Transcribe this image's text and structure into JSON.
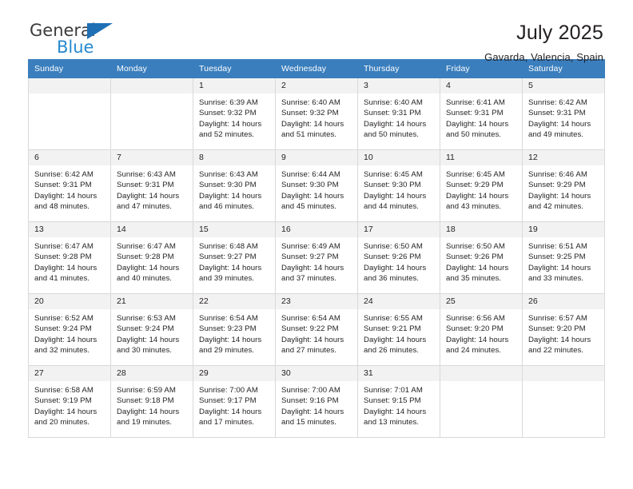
{
  "brand": {
    "name_top": "General",
    "name_bottom": "Blue",
    "triangle_color": "#1f6fb5",
    "blue_color": "#2789d0"
  },
  "header": {
    "month_title": "July 2025",
    "location": "Gavarda, Valencia, Spain"
  },
  "theme": {
    "header_bg": "#3a7ebd",
    "header_text": "#ffffff",
    "daynum_bg": "#f2f2f2",
    "grid_border": "#d9d9d9",
    "text": "#231f20"
  },
  "calendar": {
    "weekday_headers": [
      "Sunday",
      "Monday",
      "Tuesday",
      "Wednesday",
      "Thursday",
      "Friday",
      "Saturday"
    ],
    "weeks": [
      [
        {
          "day": "",
          "blank": true
        },
        {
          "day": "",
          "blank": true
        },
        {
          "day": "1",
          "sunrise": "Sunrise: 6:39 AM",
          "sunset": "Sunset: 9:32 PM",
          "daylight1": "Daylight: 14 hours",
          "daylight2": "and 52 minutes."
        },
        {
          "day": "2",
          "sunrise": "Sunrise: 6:40 AM",
          "sunset": "Sunset: 9:32 PM",
          "daylight1": "Daylight: 14 hours",
          "daylight2": "and 51 minutes."
        },
        {
          "day": "3",
          "sunrise": "Sunrise: 6:40 AM",
          "sunset": "Sunset: 9:31 PM",
          "daylight1": "Daylight: 14 hours",
          "daylight2": "and 50 minutes."
        },
        {
          "day": "4",
          "sunrise": "Sunrise: 6:41 AM",
          "sunset": "Sunset: 9:31 PM",
          "daylight1": "Daylight: 14 hours",
          "daylight2": "and 50 minutes."
        },
        {
          "day": "5",
          "sunrise": "Sunrise: 6:42 AM",
          "sunset": "Sunset: 9:31 PM",
          "daylight1": "Daylight: 14 hours",
          "daylight2": "and 49 minutes."
        }
      ],
      [
        {
          "day": "6",
          "sunrise": "Sunrise: 6:42 AM",
          "sunset": "Sunset: 9:31 PM",
          "daylight1": "Daylight: 14 hours",
          "daylight2": "and 48 minutes."
        },
        {
          "day": "7",
          "sunrise": "Sunrise: 6:43 AM",
          "sunset": "Sunset: 9:31 PM",
          "daylight1": "Daylight: 14 hours",
          "daylight2": "and 47 minutes."
        },
        {
          "day": "8",
          "sunrise": "Sunrise: 6:43 AM",
          "sunset": "Sunset: 9:30 PM",
          "daylight1": "Daylight: 14 hours",
          "daylight2": "and 46 minutes."
        },
        {
          "day": "9",
          "sunrise": "Sunrise: 6:44 AM",
          "sunset": "Sunset: 9:30 PM",
          "daylight1": "Daylight: 14 hours",
          "daylight2": "and 45 minutes."
        },
        {
          "day": "10",
          "sunrise": "Sunrise: 6:45 AM",
          "sunset": "Sunset: 9:30 PM",
          "daylight1": "Daylight: 14 hours",
          "daylight2": "and 44 minutes."
        },
        {
          "day": "11",
          "sunrise": "Sunrise: 6:45 AM",
          "sunset": "Sunset: 9:29 PM",
          "daylight1": "Daylight: 14 hours",
          "daylight2": "and 43 minutes."
        },
        {
          "day": "12",
          "sunrise": "Sunrise: 6:46 AM",
          "sunset": "Sunset: 9:29 PM",
          "daylight1": "Daylight: 14 hours",
          "daylight2": "and 42 minutes."
        }
      ],
      [
        {
          "day": "13",
          "sunrise": "Sunrise: 6:47 AM",
          "sunset": "Sunset: 9:28 PM",
          "daylight1": "Daylight: 14 hours",
          "daylight2": "and 41 minutes."
        },
        {
          "day": "14",
          "sunrise": "Sunrise: 6:47 AM",
          "sunset": "Sunset: 9:28 PM",
          "daylight1": "Daylight: 14 hours",
          "daylight2": "and 40 minutes."
        },
        {
          "day": "15",
          "sunrise": "Sunrise: 6:48 AM",
          "sunset": "Sunset: 9:27 PM",
          "daylight1": "Daylight: 14 hours",
          "daylight2": "and 39 minutes."
        },
        {
          "day": "16",
          "sunrise": "Sunrise: 6:49 AM",
          "sunset": "Sunset: 9:27 PM",
          "daylight1": "Daylight: 14 hours",
          "daylight2": "and 37 minutes."
        },
        {
          "day": "17",
          "sunrise": "Sunrise: 6:50 AM",
          "sunset": "Sunset: 9:26 PM",
          "daylight1": "Daylight: 14 hours",
          "daylight2": "and 36 minutes."
        },
        {
          "day": "18",
          "sunrise": "Sunrise: 6:50 AM",
          "sunset": "Sunset: 9:26 PM",
          "daylight1": "Daylight: 14 hours",
          "daylight2": "and 35 minutes."
        },
        {
          "day": "19",
          "sunrise": "Sunrise: 6:51 AM",
          "sunset": "Sunset: 9:25 PM",
          "daylight1": "Daylight: 14 hours",
          "daylight2": "and 33 minutes."
        }
      ],
      [
        {
          "day": "20",
          "sunrise": "Sunrise: 6:52 AM",
          "sunset": "Sunset: 9:24 PM",
          "daylight1": "Daylight: 14 hours",
          "daylight2": "and 32 minutes."
        },
        {
          "day": "21",
          "sunrise": "Sunrise: 6:53 AM",
          "sunset": "Sunset: 9:24 PM",
          "daylight1": "Daylight: 14 hours",
          "daylight2": "and 30 minutes."
        },
        {
          "day": "22",
          "sunrise": "Sunrise: 6:54 AM",
          "sunset": "Sunset: 9:23 PM",
          "daylight1": "Daylight: 14 hours",
          "daylight2": "and 29 minutes."
        },
        {
          "day": "23",
          "sunrise": "Sunrise: 6:54 AM",
          "sunset": "Sunset: 9:22 PM",
          "daylight1": "Daylight: 14 hours",
          "daylight2": "and 27 minutes."
        },
        {
          "day": "24",
          "sunrise": "Sunrise: 6:55 AM",
          "sunset": "Sunset: 9:21 PM",
          "daylight1": "Daylight: 14 hours",
          "daylight2": "and 26 minutes."
        },
        {
          "day": "25",
          "sunrise": "Sunrise: 6:56 AM",
          "sunset": "Sunset: 9:20 PM",
          "daylight1": "Daylight: 14 hours",
          "daylight2": "and 24 minutes."
        },
        {
          "day": "26",
          "sunrise": "Sunrise: 6:57 AM",
          "sunset": "Sunset: 9:20 PM",
          "daylight1": "Daylight: 14 hours",
          "daylight2": "and 22 minutes."
        }
      ],
      [
        {
          "day": "27",
          "sunrise": "Sunrise: 6:58 AM",
          "sunset": "Sunset: 9:19 PM",
          "daylight1": "Daylight: 14 hours",
          "daylight2": "and 20 minutes."
        },
        {
          "day": "28",
          "sunrise": "Sunrise: 6:59 AM",
          "sunset": "Sunset: 9:18 PM",
          "daylight1": "Daylight: 14 hours",
          "daylight2": "and 19 minutes."
        },
        {
          "day": "29",
          "sunrise": "Sunrise: 7:00 AM",
          "sunset": "Sunset: 9:17 PM",
          "daylight1": "Daylight: 14 hours",
          "daylight2": "and 17 minutes."
        },
        {
          "day": "30",
          "sunrise": "Sunrise: 7:00 AM",
          "sunset": "Sunset: 9:16 PM",
          "daylight1": "Daylight: 14 hours",
          "daylight2": "and 15 minutes."
        },
        {
          "day": "31",
          "sunrise": "Sunrise: 7:01 AM",
          "sunset": "Sunset: 9:15 PM",
          "daylight1": "Daylight: 14 hours",
          "daylight2": "and 13 minutes."
        },
        {
          "day": "",
          "blank": true
        },
        {
          "day": "",
          "blank": true
        }
      ]
    ]
  }
}
